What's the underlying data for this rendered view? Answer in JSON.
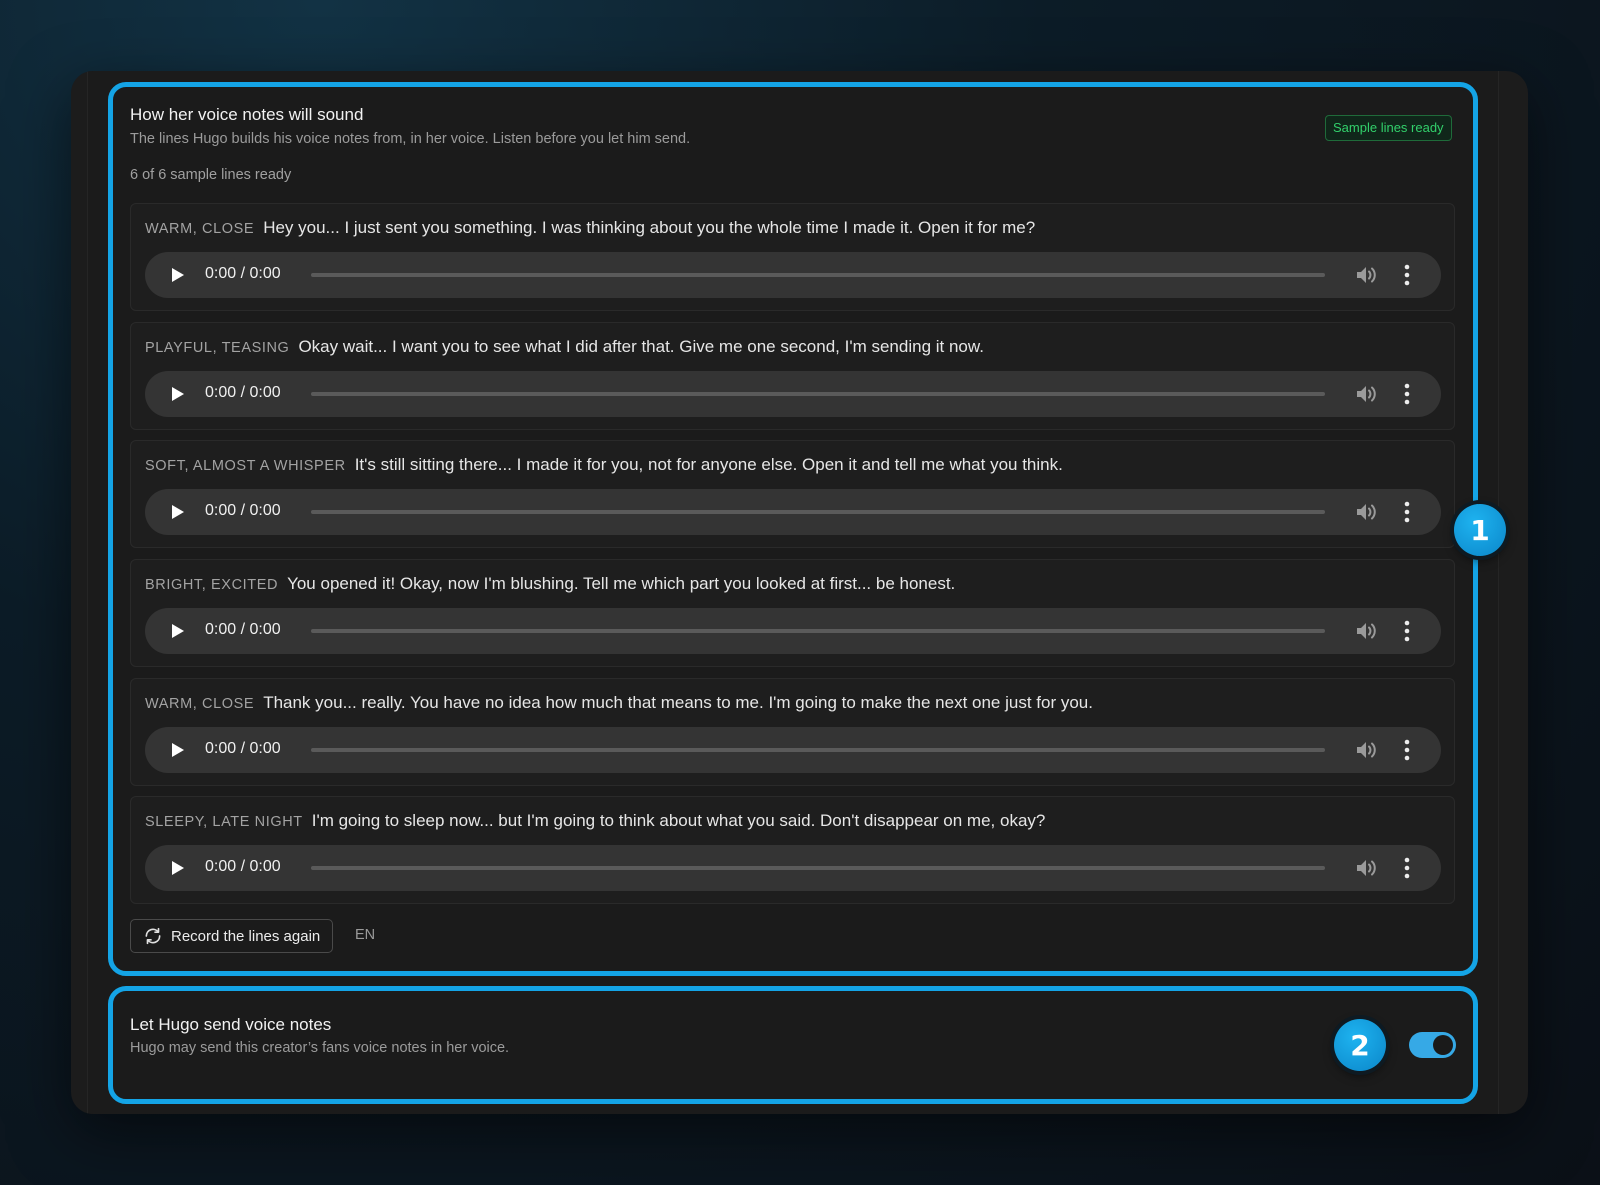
{
  "voice_section": {
    "title": "How her voice notes will sound",
    "subtitle": "The lines Hugo builds his voice notes from, in her voice. Listen before you let him send.",
    "status_badge": "Sample lines ready",
    "count_text": "6 of 6 sample lines ready",
    "samples": [
      {
        "tone": "WARM, CLOSE",
        "text": "Hey you... I just sent you something. I was thinking about you the whole time I made it. Open it for me?",
        "time": "0:00 / 0:00"
      },
      {
        "tone": "PLAYFUL, TEASING",
        "text": "Okay wait... I want you to see what I did after that. Give me one second, I'm sending it now.",
        "time": "0:00 / 0:00"
      },
      {
        "tone": "SOFT, ALMOST A WHISPER",
        "text": "It's still sitting there... I made it for you, not for anyone else. Open it and tell me what you think.",
        "time": "0:00 / 0:00"
      },
      {
        "tone": "BRIGHT, EXCITED",
        "text": "You opened it! Okay, now I'm blushing. Tell me which part you looked at first... be honest.",
        "time": "0:00 / 0:00"
      },
      {
        "tone": "WARM, CLOSE",
        "text": "Thank you... really. You have no idea how much that means to me. I'm going to make the next one just for you.",
        "time": "0:00 / 0:00"
      },
      {
        "tone": "SLEEPY, LATE NIGHT",
        "text": "I'm going to sleep now... but I'm going to think about what you said. Don't disappear on me, okay?",
        "time": "0:00 / 0:00"
      }
    ],
    "record_button_label": "Record the lines again",
    "language": "EN"
  },
  "send_section": {
    "title": "Let Hugo send voice notes",
    "subtitle": "Hugo may send this creator’s fans voice notes in her voice.",
    "toggle_on": true
  },
  "callouts": [
    "1",
    "2"
  ],
  "colors": {
    "highlight": "#14a4e6",
    "badge_text": "#32d06b",
    "toggle": "#36a9e6"
  },
  "icons": {
    "play": "play-icon",
    "volume": "volume-icon",
    "more": "more-vertical-icon",
    "refresh": "refresh-icon"
  }
}
